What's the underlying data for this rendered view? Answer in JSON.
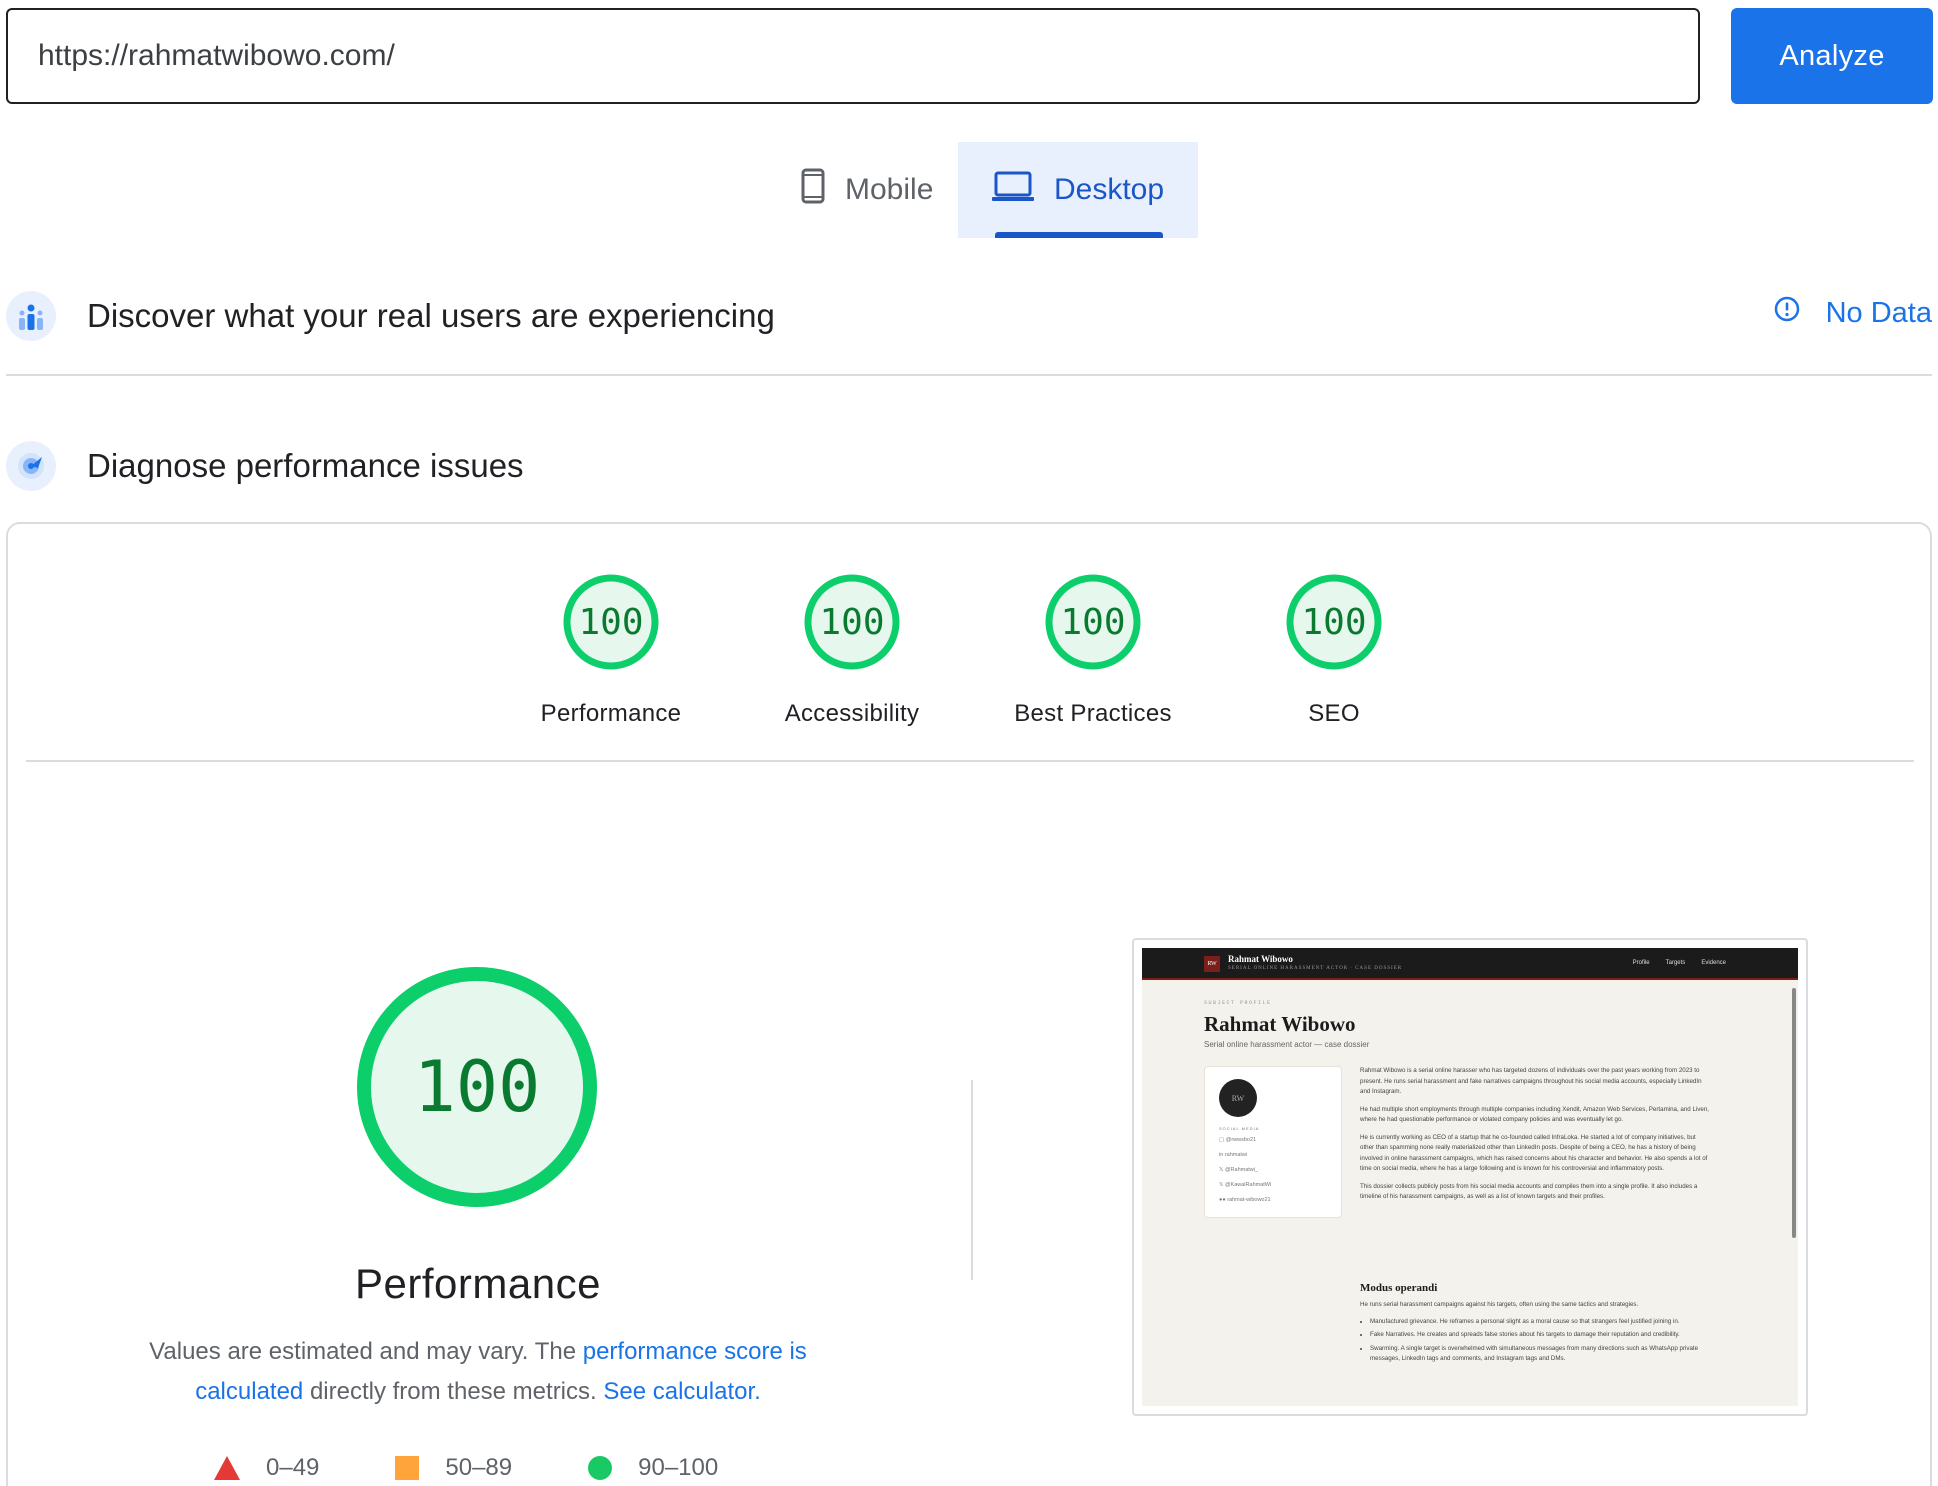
{
  "url_bar": {
    "value": "https://rahmatwibowo.com/",
    "analyze_label": "Analyze"
  },
  "device_tabs": {
    "mobile_label": "Mobile",
    "desktop_label": "Desktop",
    "selected": "Desktop"
  },
  "crux": {
    "title": "Discover what your real users are experiencing",
    "status": "No Data"
  },
  "diagnose": {
    "title": "Diagnose performance issues"
  },
  "category_scores": [
    {
      "label": "Performance",
      "score": "100"
    },
    {
      "label": "Accessibility",
      "score": "100"
    },
    {
      "label": "Best Practices",
      "score": "100"
    },
    {
      "label": "SEO",
      "score": "100"
    }
  ],
  "performance": {
    "score": "100",
    "title": "Performance",
    "desc_prefix": "Values are estimated and may vary. The ",
    "desc_link1": "performance score is calculated",
    "desc_mid": " directly from these metrics. ",
    "desc_link2": "See calculator."
  },
  "legend": {
    "poor": "0–49",
    "average": "50–89",
    "good": "90–100"
  },
  "colors": {
    "accent": "#1a73e8",
    "good": "#0cce6b",
    "average": "#ffa400",
    "poor": "#ff4e42"
  },
  "screenshot": {
    "brand": "Rahmat Wibowo",
    "brand_sub": "SERIAL ONLINE HARASSMENT ACTOR · CASE DOSSIER",
    "logo": "RW",
    "nav_links": [
      "Profile",
      "Targets",
      "Evidence"
    ],
    "eyebrow": "SUBJECT PROFILE",
    "title": "Rahmat Wibowo",
    "tagline": "Serial online harassment actor — case dossier",
    "avatar": "RW",
    "social_label": "SOCIAL MEDIA",
    "socials": [
      "@rwwsbo21",
      "rahmatwi",
      "@Rahmatwi_",
      "@KawalRahmatWi",
      "rahmat-wibowo21"
    ],
    "paragraphs": [
      "Rahmat Wibowo is a serial online harasser who has targeted dozens of individuals over the past years working from 2023 to present. He runs serial harassment and fake narratives campaigns throughout his social media accounts, especially LinkedIn and Instagram.",
      "He had multiple short employments through multiple companies including Xendit, Amazon Web Services, Pertamina, and Liven, where he had questionable performance or violated company policies and was eventually let go.",
      "He is currently working as CEO of a startup that he co-founded called InfraLoka. He started a lot of company initiatives, but other than spamming none really materialized other than LinkedIn posts. Despite of being a CEO, he has a history of being involved in online harassment campaigns, which has raised concerns about his character and behavior. He also spends a lot of time on social media, where he has a large following and is known for his controversial and inflammatory posts.",
      "This dossier collects publicly posts from his social media accounts and compiles them into a single profile. It also includes a timeline of his harassment campaigns, as well as a list of known targets and their profiles."
    ],
    "section_heading": "Modus operandi",
    "section_intro": "He runs serial harassment campaigns against his targets, often using the same tactics and strategies.",
    "bullets": [
      "Manufactured grievance. He reframes a personal slight as a moral cause so that strangers feel justified joining in.",
      "Fake Narratives. He creates and spreads false stories about his targets to damage their reputation and credibility.",
      "Swarming. A single target is overwhelmed with simultaneous messages from many directions such as WhatsApp private messages, LinkedIn tags and comments, and Instagram tags and DMs."
    ]
  }
}
